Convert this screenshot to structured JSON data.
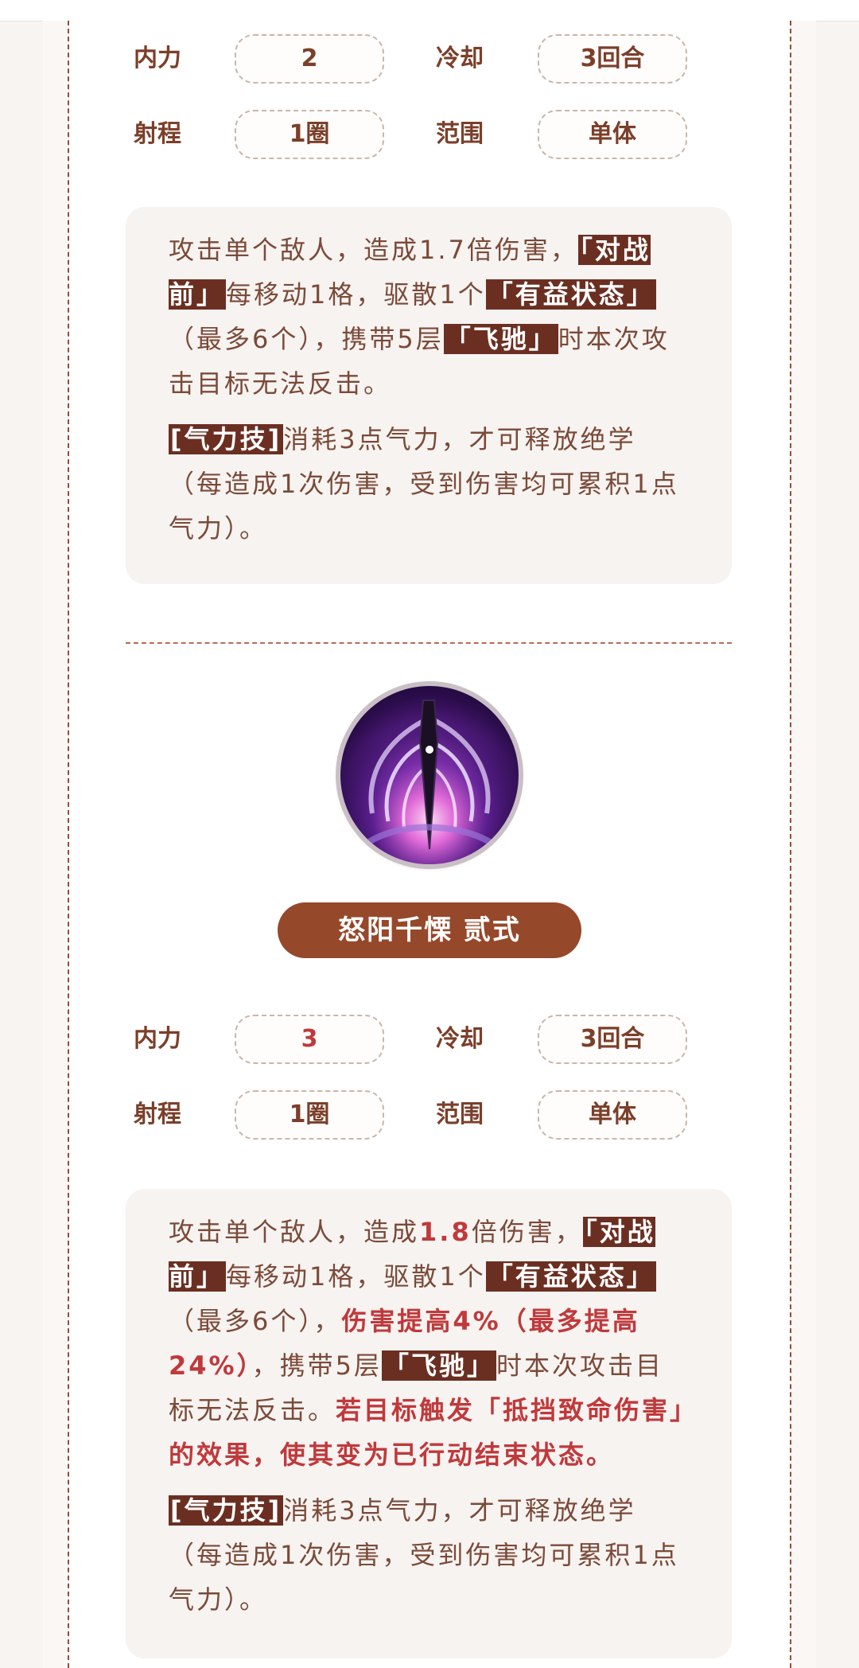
{
  "skill1": {
    "stats": {
      "neili_label": "内力",
      "neili_value": "2",
      "cooldown_label": "冷却",
      "cooldown_value": "3回合",
      "range_label": "射程",
      "range_value": "1圈",
      "scope_label": "范围",
      "scope_value": "单体"
    },
    "desc": {
      "p1_a": "攻击单个敌人，造成1.7倍伤害，",
      "p1_tag1": "「对战前」",
      "p1_b": "每移动1格，驱散1个",
      "p1_tag2": "「有益状态」",
      "p1_c": "（最多6个），携带5层",
      "p1_tag3": "「飞驰」",
      "p1_d": "时本次攻击目标无法反击。",
      "p2_tag": "[气力技]",
      "p2_text": "消耗3点气力，才可释放绝学（每造成1次伤害，受到伤害均可累积1点气力）。"
    }
  },
  "skill2": {
    "icon": "purple-blade-skill-icon",
    "name": "怒阳千慄 贰式",
    "stats": {
      "neili_label": "内力",
      "neili_value": "3",
      "cooldown_label": "冷却",
      "cooldown_value": "3回合",
      "range_label": "射程",
      "range_value": "1圈",
      "scope_label": "范围",
      "scope_value": "单体"
    },
    "desc": {
      "p1_a": "攻击单个敌人，造成",
      "p1_red1": "1.8",
      "p1_b": "倍伤害，",
      "p1_tag1": "「对战前」",
      "p1_c": "每移动1格，驱散1个",
      "p1_tag2": "「有益状态」",
      "p1_d": "（最多6个），",
      "p1_red2": "伤害提高4%（最多提高24%）",
      "p1_e": "，携带5层",
      "p1_tag3": "「飞驰」",
      "p1_f": "时本次攻击目标无法反击。",
      "p1_red3": "若目标触发「抵挡致命伤害」的效果，使其变为已行动结束状态。",
      "p2_tag": "[气力技]",
      "p2_text": "消耗3点气力，才可释放绝学（每造成1次伤害，受到伤害均可累积1点气力）。"
    }
  },
  "colors": {
    "accent": "#96482b",
    "tag_bg": "#6b2f22",
    "highlight_red": "#c0393b",
    "text_brown": "#7b3f2a"
  }
}
